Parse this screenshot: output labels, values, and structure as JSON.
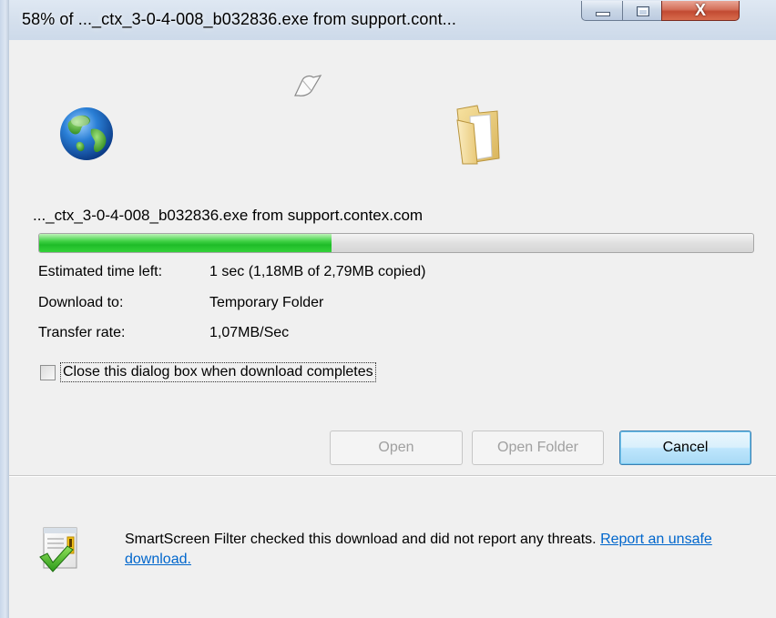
{
  "window": {
    "title": "58% of ..._ctx_3-0-4-008_b032836.exe from support.cont...",
    "close_glyph": "X"
  },
  "download": {
    "filename": "..._ctx_3-0-4-008_b032836.exe from support.contex.com",
    "progress_fraction": 0.41,
    "rows": [
      {
        "label": "Estimated time left:",
        "value": "1 sec (1,18MB of 2,79MB copied)"
      },
      {
        "label": "Download to:",
        "value": "Temporary Folder"
      },
      {
        "label": "Transfer rate:",
        "value": "1,07MB/Sec"
      }
    ],
    "close_when_complete": {
      "label": "Close this dialog box when download completes",
      "checked": false
    }
  },
  "buttons": {
    "open": "Open",
    "open_folder": "Open Folder",
    "cancel": "Cancel"
  },
  "footer": {
    "message": "SmartScreen Filter checked this download and did not report any threats. ",
    "link": "Report an unsafe download."
  },
  "icons": {
    "globe": "globe-icon",
    "paper": "flying-paper-icon",
    "folder": "folder-icon",
    "shield": "smartscreen-check-icon"
  },
  "colors": {
    "progress_green": "#32cd32",
    "link_blue": "#0066cc",
    "close_red": "#c24a32"
  }
}
